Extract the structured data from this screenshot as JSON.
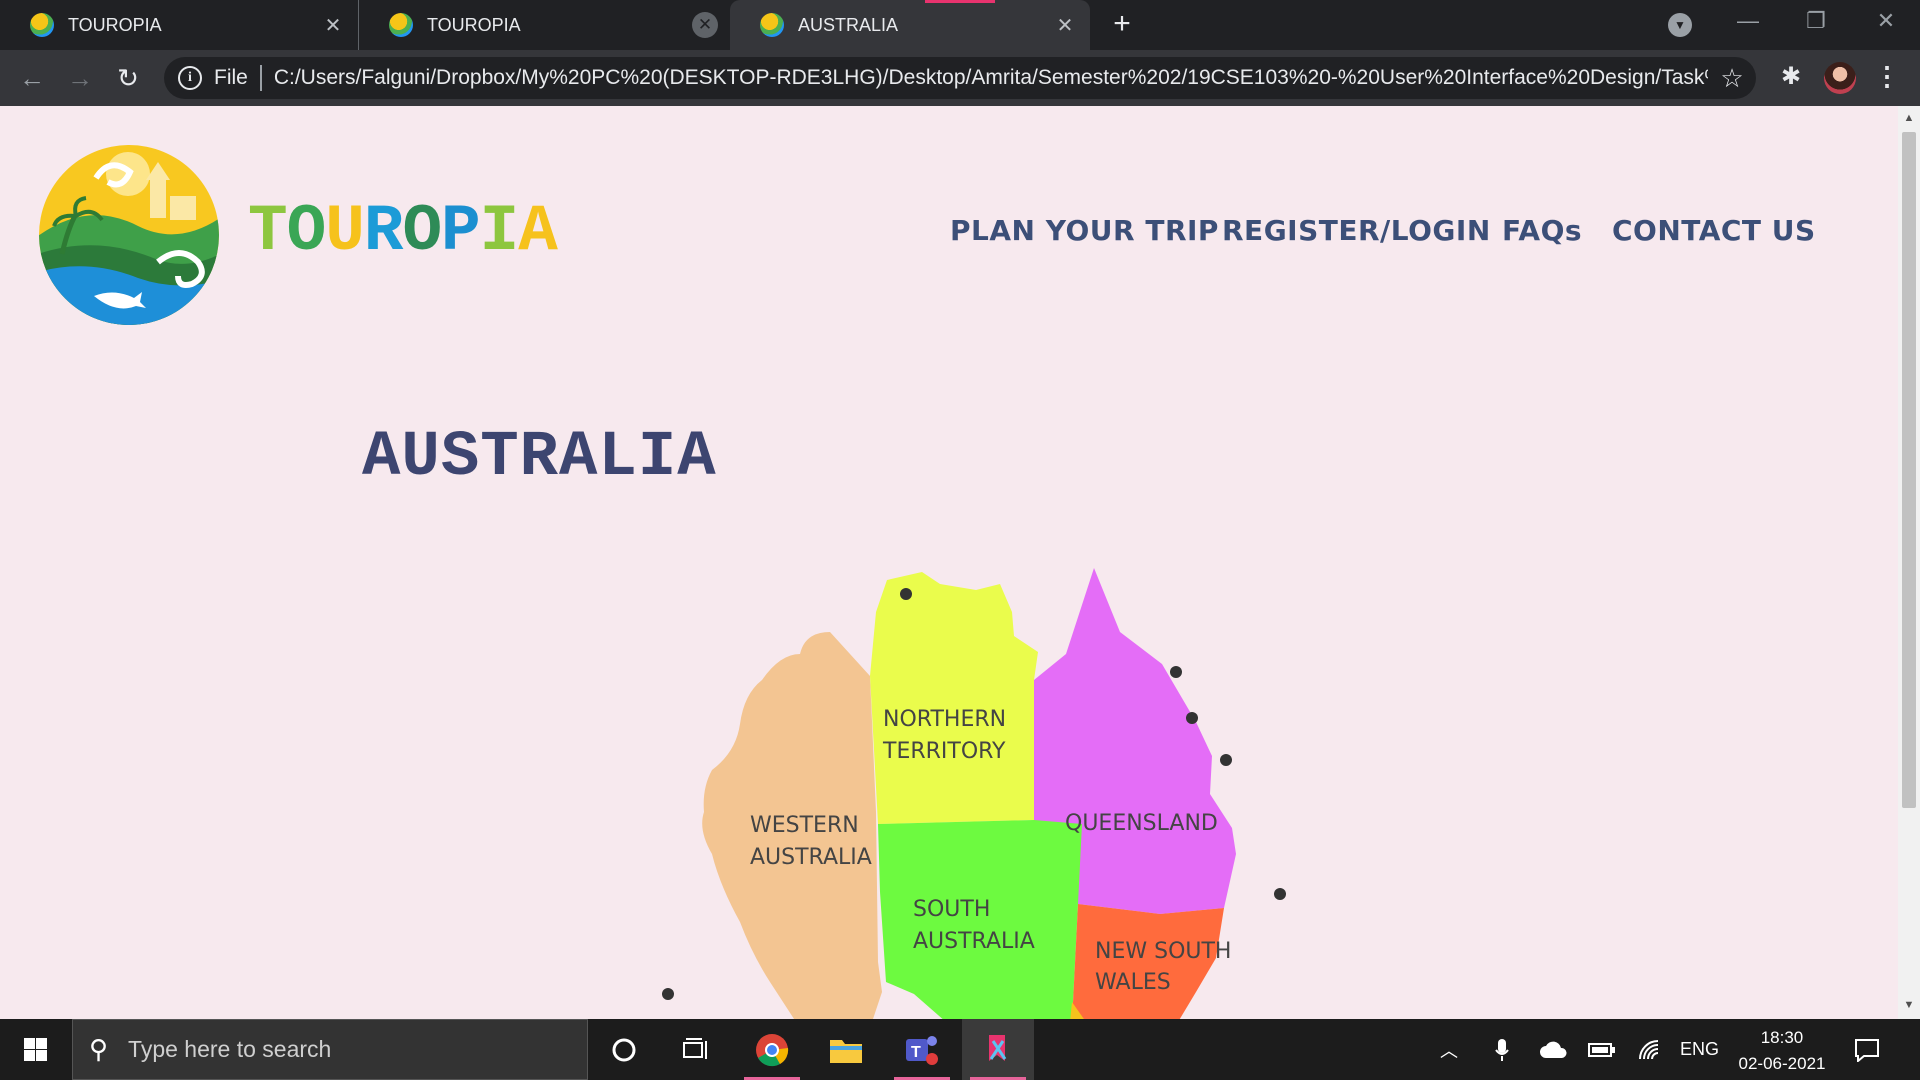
{
  "browser": {
    "tabs": [
      {
        "title": "TOUROPIA"
      },
      {
        "title": "TOUROPIA"
      },
      {
        "title": "AUSTRALIA"
      }
    ],
    "address": {
      "scheme_label": "File",
      "url": "C:/Users/Falguni/Dropbox/My%20PC%20(DESKTOP-RDE3LHG)/Desktop/Amrita/Semester%202/19CSE103%20-%20User%20Interface%20Design/Task%2..."
    }
  },
  "site": {
    "brand": {
      "letters": [
        {
          "char": "T",
          "color": "#8dc63f"
        },
        {
          "char": "O",
          "color": "#3aa655"
        },
        {
          "char": "U",
          "color": "#f6c21c"
        },
        {
          "char": "R",
          "color": "#1c9bd7"
        },
        {
          "char": "O",
          "color": "#2e8b57"
        },
        {
          "char": "P",
          "color": "#1c8fd0"
        },
        {
          "char": "I",
          "color": "#8dc63f"
        },
        {
          "char": "A",
          "color": "#f6c21c"
        }
      ]
    },
    "nav": {
      "plan": "PLAN YOUR TRIP",
      "register": "REGISTER/LOGIN",
      "faqs": "FAQs",
      "contact": "CONTACT US"
    },
    "page_title": "AUSTRALIA",
    "map": {
      "regions": {
        "wa": {
          "line1": "WESTERN",
          "line2": "AUSTRALIA",
          "color": "#f3c592"
        },
        "nt": {
          "line1": "NORTHERN",
          "line2": "TERRITORY",
          "color": "#eafc4c"
        },
        "qld": {
          "line1": "QUEENSLAND",
          "color": "#e46df7"
        },
        "sa": {
          "line1": "SOUTH",
          "line2": "AUSTRALIA",
          "color": "#6dfa40"
        },
        "nsw": {
          "line1": "NEW SOUTH",
          "line2": "WALES",
          "color": "#ff6b3d"
        }
      }
    }
  },
  "taskbar": {
    "search_placeholder": "Type here to search",
    "language": "ENG",
    "time": "18:30",
    "date": "02-06-2021"
  }
}
